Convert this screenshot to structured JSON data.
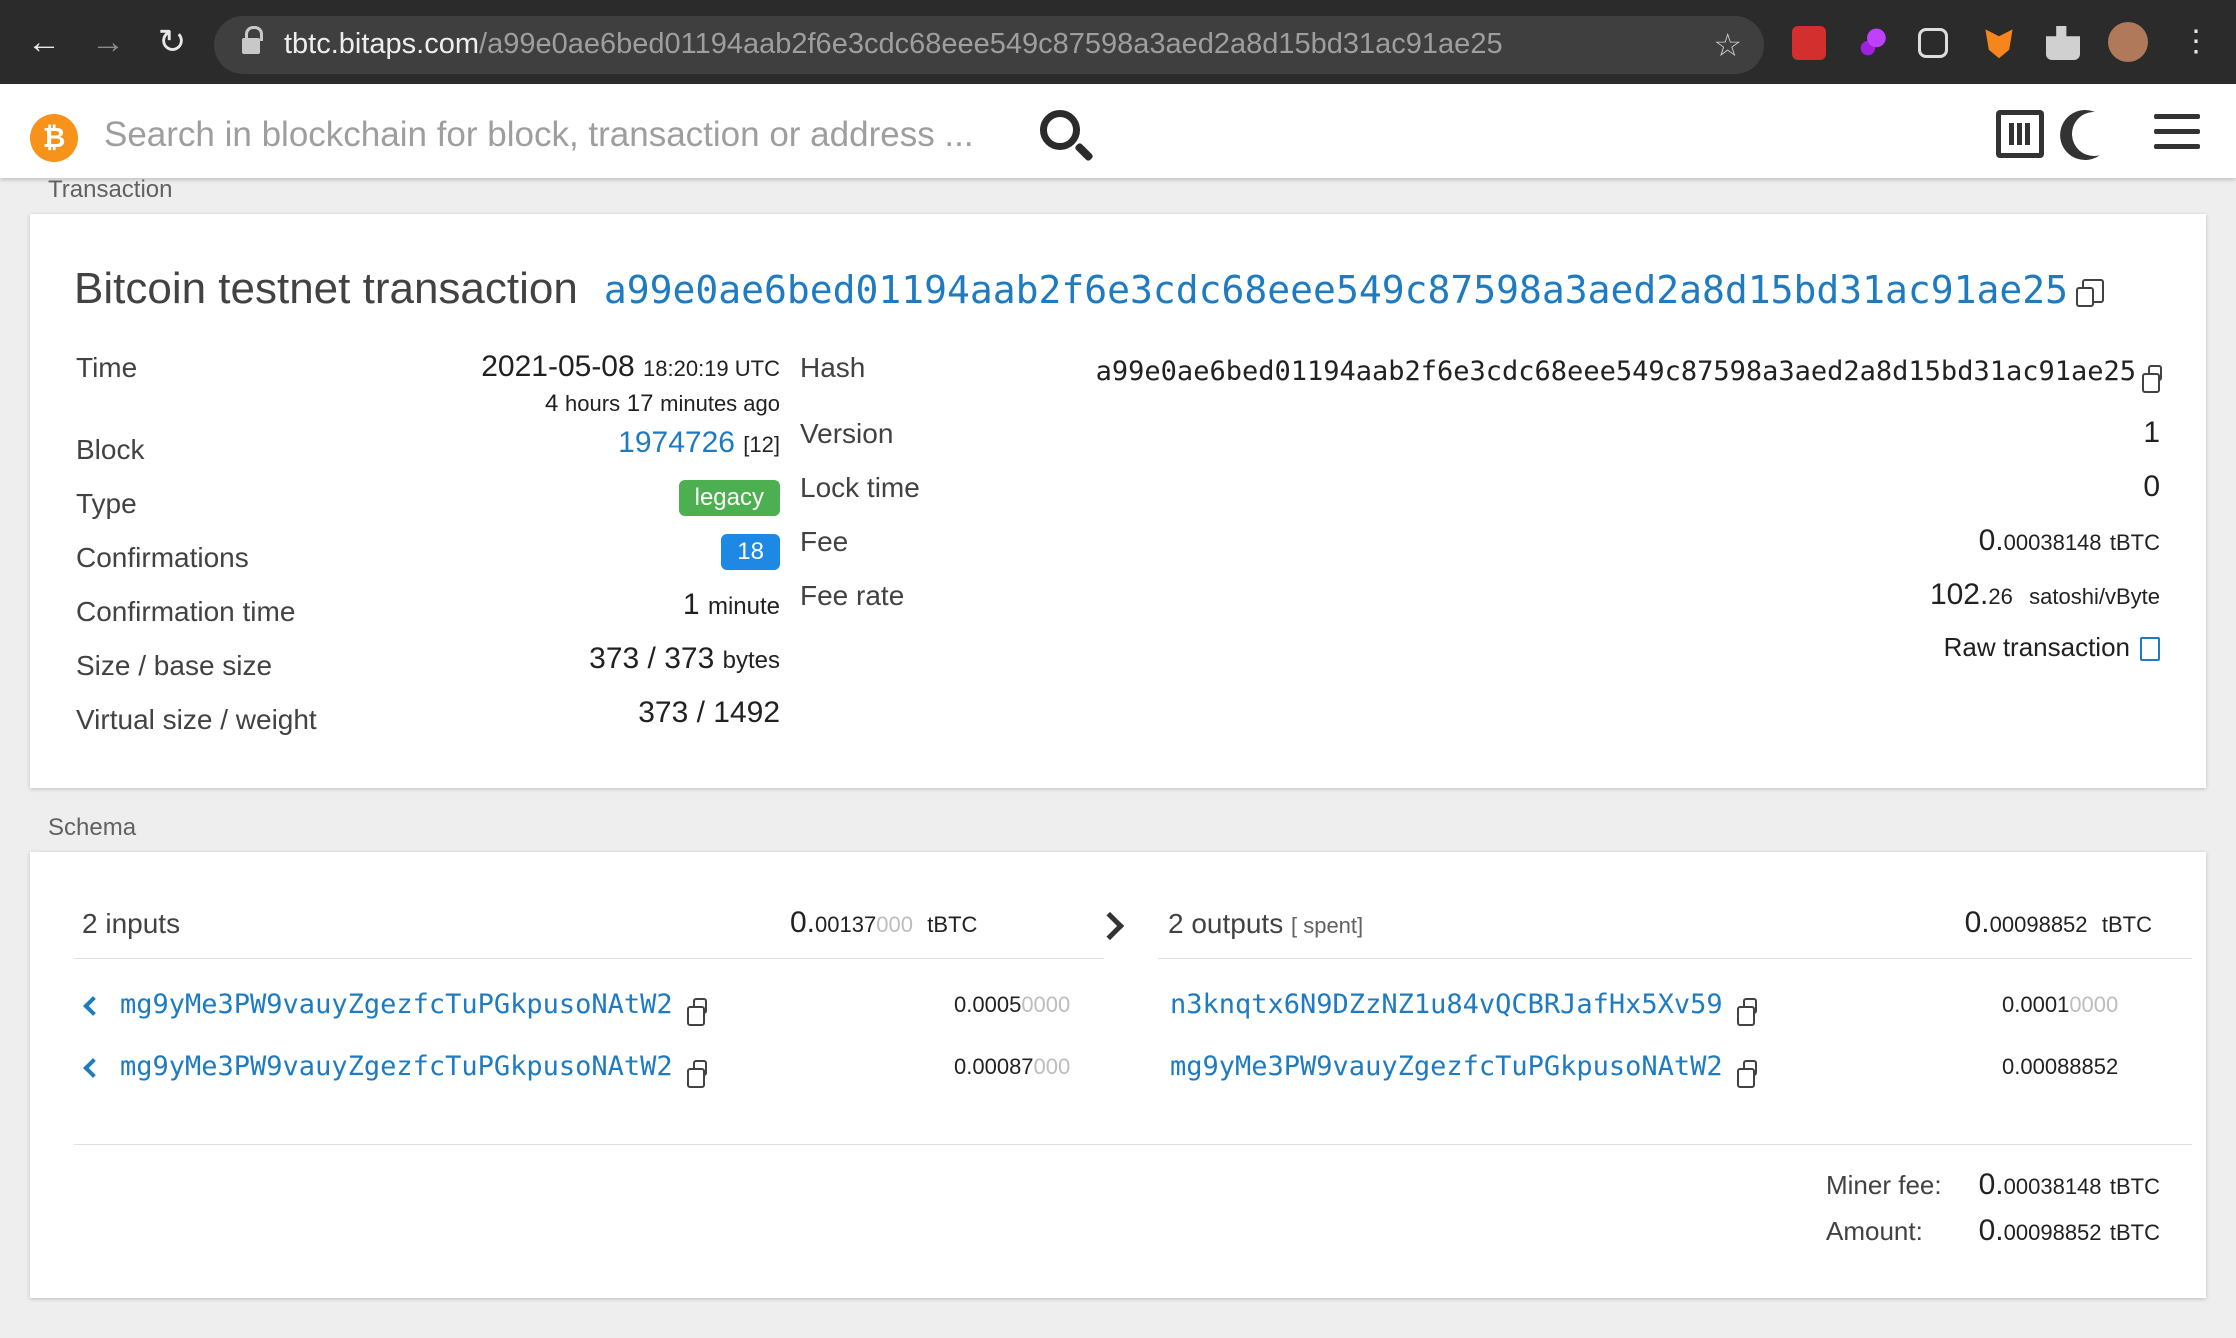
{
  "browser": {
    "url_host": "tbtc.bitaps.com",
    "url_path": "/a99e0ae6bed01194aab2f6e3cdc68eee549c87598a3aed2a8d15bd31ac91ae25"
  },
  "header": {
    "search_placeholder": "Search in blockchain for block, transaction or address ..."
  },
  "transaction_section_label": "Transaction",
  "tx": {
    "title": "Bitcoin testnet transaction",
    "title_hash": "a99e0ae6bed01194aab2f6e3cdc68eee549c87598a3aed2a8d15bd31ac91ae25",
    "left": {
      "time_label": "Time",
      "time_date": "2021-05-08",
      "time_clock": "18:20:19 UTC",
      "age_hours": "4",
      "age_hours_unit": "hours",
      "age_minutes": "17",
      "age_minutes_unit": "minutes ago",
      "block_label": "Block",
      "block_value": "1974726",
      "block_index": "[12]",
      "type_label": "Type",
      "type_value": "legacy",
      "confirmations_label": "Confirmations",
      "confirmations_value": "18",
      "conf_time_label": "Confirmation time",
      "conf_time_value": "1",
      "conf_time_unit": "minute",
      "size_label": "Size / base size",
      "size_value": "373 / 373",
      "size_unit": "bytes",
      "vsize_label": "Virtual size / weight",
      "vsize_value": "373 / 1492"
    },
    "right": {
      "hash_label": "Hash",
      "hash_value": "a99e0ae6bed01194aab2f6e3cdc68eee549c87598a3aed2a8d15bd31ac91ae25",
      "version_label": "Version",
      "version_value": "1",
      "locktime_label": "Lock time",
      "locktime_value": "0",
      "fee_label": "Fee",
      "fee_int": "0.",
      "fee_frac": "00038148",
      "fee_unit": "tBTC",
      "feerate_label": "Fee rate",
      "feerate_int": "102.",
      "feerate_frac": "26",
      "feerate_unit": "satoshi/vByte",
      "raw_link": "Raw transaction"
    }
  },
  "schema_section_label": "Schema",
  "schema": {
    "inputs_title": "2 inputs",
    "inputs_total_int": "0.",
    "inputs_total_frac": "00137",
    "inputs_total_trail": "000",
    "inputs_total_unit": "tBTC",
    "outputs_title": "2 outputs",
    "outputs_spent": "[ spent]",
    "outputs_total_int": "0.",
    "outputs_total_frac": "00098852",
    "outputs_total_unit": "tBTC",
    "inputs": [
      {
        "address": "mg9yMe3PW9vauyZgezfcTuPGkpusoNAtW2",
        "amount_int": "0.",
        "amount_frac": "0005",
        "amount_trail": "0000"
      },
      {
        "address": "mg9yMe3PW9vauyZgezfcTuPGkpusoNAtW2",
        "amount_int": "0.",
        "amount_frac": "00087",
        "amount_trail": "000"
      }
    ],
    "outputs": [
      {
        "address": "n3knqtx6N9DZzNZ1u84vQCBRJafHx5Xv59",
        "amount_int": "0.",
        "amount_frac": "0001",
        "amount_trail": "0000"
      },
      {
        "address": "mg9yMe3PW9vauyZgezfcTuPGkpusoNAtW2",
        "amount_int": "0.",
        "amount_frac": "00088852",
        "amount_trail": ""
      }
    ],
    "miner_fee_label": "Miner fee:",
    "miner_fee_int": "0.",
    "miner_fee_frac": "00038148",
    "miner_fee_unit": "tBTC",
    "amount_label": "Amount:",
    "amount_int": "0.",
    "amount_frac": "00098852",
    "amount_unit": "tBTC"
  },
  "colors": {
    "link": "#1f7bc1",
    "legacy_badge": "#4caf50",
    "confirm_badge": "#1e88e5",
    "brand": "#f7931a"
  }
}
